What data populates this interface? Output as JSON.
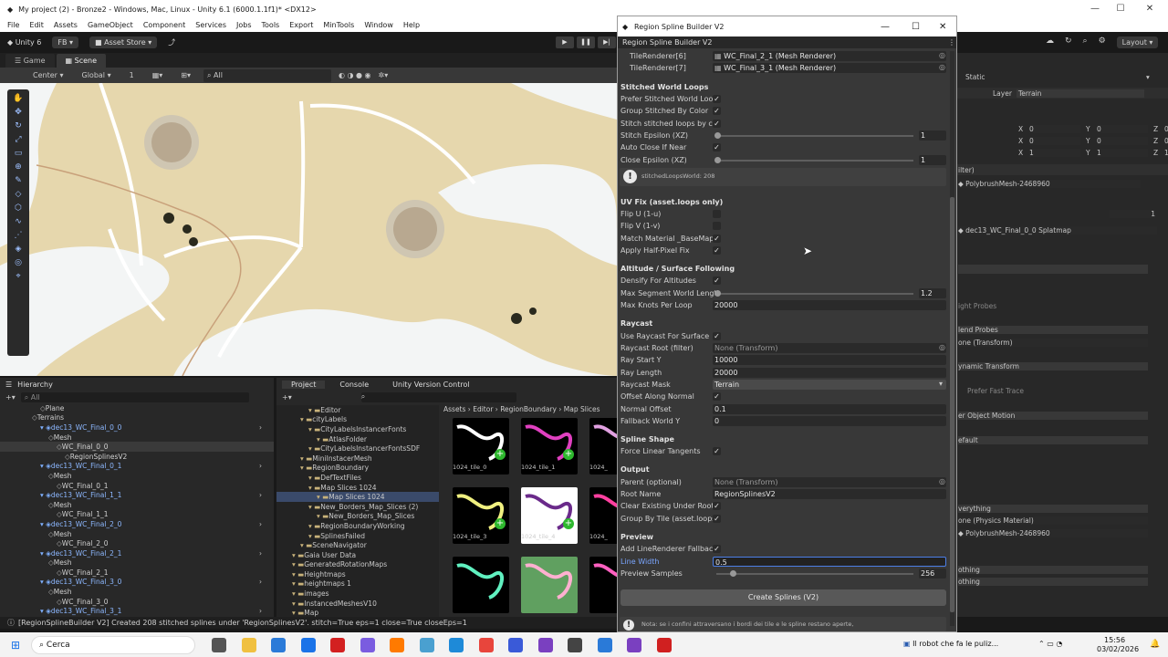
{
  "window": {
    "title": "My project (2) - Bronze2 - Windows, Mac, Linux - Unity 6.1 (6000.1.1f1)* <DX12>"
  },
  "menu": [
    "File",
    "Edit",
    "Assets",
    "GameObject",
    "Component",
    "Services",
    "Jobs",
    "Tools",
    "Export",
    "MinTools",
    "Window",
    "Help"
  ],
  "toolbar": {
    "unity": "Unity 6",
    "account": "FB",
    "asset_store": "Asset Store",
    "layout": "Layout"
  },
  "scene_tabs": [
    "Game",
    "Scene"
  ],
  "scene_opts": {
    "pivot": "Center",
    "space": "Global",
    "grid": "1",
    "search": "All"
  },
  "hierarchy": {
    "title": "Hierarchy",
    "search": "All",
    "items": [
      {
        "d": 4,
        "t": "Plane"
      },
      {
        "d": 3,
        "t": "Terrains"
      },
      {
        "d": 4,
        "t": "dec13_WC_Final_0_0",
        "c": true
      },
      {
        "d": 5,
        "t": "Mesh"
      },
      {
        "d": 6,
        "t": "WC_Final_0_0",
        "sel": true
      },
      {
        "d": 7,
        "t": "RegionSplinesV2"
      },
      {
        "d": 4,
        "t": "dec13_WC_Final_0_1",
        "c": true
      },
      {
        "d": 5,
        "t": "Mesh"
      },
      {
        "d": 6,
        "t": "WC_Final_0_1"
      },
      {
        "d": 4,
        "t": "dec13_WC_Final_1_1",
        "c": true
      },
      {
        "d": 5,
        "t": "Mesh"
      },
      {
        "d": 6,
        "t": "WC_Final_1_1"
      },
      {
        "d": 4,
        "t": "dec13_WC_Final_2_0",
        "c": true
      },
      {
        "d": 5,
        "t": "Mesh"
      },
      {
        "d": 6,
        "t": "WC_Final_2_0"
      },
      {
        "d": 4,
        "t": "dec13_WC_Final_2_1",
        "c": true
      },
      {
        "d": 5,
        "t": "Mesh"
      },
      {
        "d": 6,
        "t": "WC_Final_2_1"
      },
      {
        "d": 4,
        "t": "dec13_WC_Final_3_0",
        "c": true
      },
      {
        "d": 5,
        "t": "Mesh"
      },
      {
        "d": 6,
        "t": "WC_Final_3_0"
      },
      {
        "d": 4,
        "t": "dec13_WC_Final_3_1",
        "c": true
      },
      {
        "d": 5,
        "t": "Mesh"
      }
    ]
  },
  "project": {
    "tabs": [
      "Project",
      "Console",
      "Unity Version Control"
    ],
    "breadcrumb": [
      "Assets",
      "Editor",
      "RegionBoundary",
      "Map Slices"
    ],
    "tree": [
      {
        "d": 3,
        "t": "Editor"
      },
      {
        "d": 2,
        "t": "cityLabels"
      },
      {
        "d": 3,
        "t": "CityLabelsInstancerFonts"
      },
      {
        "d": 4,
        "t": "AtlasFolder"
      },
      {
        "d": 3,
        "t": "CityLabelsInstancerFontsSDF"
      },
      {
        "d": 2,
        "t": "MiniInstacerMesh"
      },
      {
        "d": 2,
        "t": "RegionBoundary"
      },
      {
        "d": 3,
        "t": "DefTextFiles"
      },
      {
        "d": 3,
        "t": "Map Slices 1024"
      },
      {
        "d": 4,
        "t": "Map Slices 1024",
        "sel": true
      },
      {
        "d": 3,
        "t": "New_Borders_Map_Slices (2)"
      },
      {
        "d": 4,
        "t": "New_Borders_Map_Slices"
      },
      {
        "d": 3,
        "t": "RegionBoundaryWorking"
      },
      {
        "d": 3,
        "t": "SplinesFailed"
      },
      {
        "d": 2,
        "t": "SceneNavigator"
      },
      {
        "d": 1,
        "t": "Gaia User Data"
      },
      {
        "d": 1,
        "t": "GeneratedRotationMaps"
      },
      {
        "d": 1,
        "t": "Heightmaps"
      },
      {
        "d": 1,
        "t": "heightmaps 1"
      },
      {
        "d": 1,
        "t": "images"
      },
      {
        "d": 1,
        "t": "InstancedMeshesV10"
      },
      {
        "d": 1,
        "t": "Map"
      }
    ],
    "assets": [
      "1024_tile_0",
      "1024_tile_1",
      "1024_",
      "1024_tile_3",
      "1024_tile_4",
      "1024_",
      "",
      "",
      ""
    ]
  },
  "status": "[RegionSplineBuilder V2] Created 208 stitched splines under 'RegionSplinesV2'. stitch=True eps=1 close=True closeEps=1",
  "rsb": {
    "window_title": "Region Spline Builder V2",
    "tab": "Region Spline Builder V2",
    "tile_renderers": [
      {
        "label": "TileRenderer[6]",
        "value": "WC_Final_2_1 (Mesh Renderer)"
      },
      {
        "label": "TileRenderer[7]",
        "value": "WC_Final_3_1 (Mesh Renderer)"
      }
    ],
    "stitched": {
      "header": "Stitched World Loops",
      "prefer": "Prefer Stitched World Loop",
      "prefer_v": true,
      "group": "Group Stitched By Color",
      "group_v": true,
      "stitch": "Stitch stitched loops by co",
      "stitch_v": true,
      "eps": "Stitch Epsilon (XZ)",
      "eps_v": "1",
      "eps_frac": 0.0,
      "auto": "Auto Close If Near",
      "auto_v": true,
      "close": "Close Epsilon (XZ)",
      "close_v": "1",
      "close_frac": 0.0,
      "info": "stitchedLoopsWorld: 208"
    },
    "uv": {
      "header": "UV Fix (asset.loops only)",
      "flipu": "Flip U (1-u)",
      "flipu_v": false,
      "flipv": "Flip V (1-v)",
      "flipv_v": false,
      "match": "Match Material _BaseMap.",
      "match_v": true,
      "half": "Apply Half-Pixel Fix",
      "half_v": true
    },
    "alt": {
      "header": "Altitude / Surface Following",
      "densify": "Densify For Altitudes",
      "densify_v": true,
      "maxseg": "Max Segment World Lengt",
      "maxseg_v": "1.2",
      "maxseg_frac": 0.0,
      "maxknots": "Max Knots Per Loop",
      "maxknots_v": "20000"
    },
    "ray": {
      "header": "Raycast",
      "use": "Use Raycast For Surface",
      "use_v": true,
      "root": "Raycast Root (filter)",
      "root_v": "None (Transform)",
      "starty": "Ray Start Y",
      "starty_v": "10000",
      "length": "Ray Length",
      "length_v": "20000",
      "mask": "Raycast Mask",
      "mask_v": "Terrain",
      "offn": "Offset Along Normal",
      "offn_v": true,
      "noff": "Normal Offset",
      "noff_v": "0.1",
      "fby": "Fallback World Y",
      "fby_v": "0"
    },
    "shape": {
      "header": "Spline Shape",
      "force": "Force Linear Tangents",
      "force_v": true
    },
    "output": {
      "header": "Output",
      "parent": "Parent (optional)",
      "parent_v": "None (Transform)",
      "root": "Root Name",
      "root_v": "RegionSplinesV2",
      "clear": "Clear Existing Under Root",
      "clear_v": true,
      "grp": "Group By Tile (asset.loops",
      "grp_v": true
    },
    "preview": {
      "header": "Preview",
      "add": "Add LineRenderer Fallback",
      "add_v": true,
      "lw": "Line Width",
      "lw_v": "0.5",
      "samples": "Preview Samples",
      "samples_v": "256",
      "samples_frac": 0.08
    },
    "create": "Create Splines (V2)",
    "note": "Nota: se i confini attraversano i bordi dei tile e le spline restano aperte,"
  },
  "inspector": {
    "static": "Static",
    "layer_label": "Layer",
    "layer": "Terrain",
    "p": [
      [
        "X",
        "0",
        "Y",
        "0",
        "Z",
        "0"
      ],
      [
        "X",
        "0",
        "Y",
        "0",
        "Z",
        "0"
      ],
      [
        "X",
        "1",
        "Y",
        "1",
        "Z",
        "1"
      ]
    ],
    "filter": "ilter)",
    "mesh": "PolybrushMesh-2468960",
    "count": "1",
    "splatmap": "dec13_WC_Final_0_0 Splatmap",
    "probes": "ight Probes",
    "blend": "lend Probes",
    "none_t": "one (Transform)",
    "dyn": "ynamic Transform",
    "fast": "Prefer Fast Trace",
    "motion": "er Object Motion",
    "def": "efault",
    "every": "verything",
    "phys": "one (Physics Material)",
    "mesh2": "PolybrushMesh-2468960",
    "noth1": "othing",
    "noth2": "othing"
  },
  "taskbar": {
    "search": "Cerca",
    "notif": "Il robot che fa le puliz...",
    "time": "15:56",
    "date": "03/02/2026"
  },
  "colors": {
    "accent": "#4c7ee6",
    "sand": "#e6d7ad",
    "water": "#f3f5f5"
  }
}
